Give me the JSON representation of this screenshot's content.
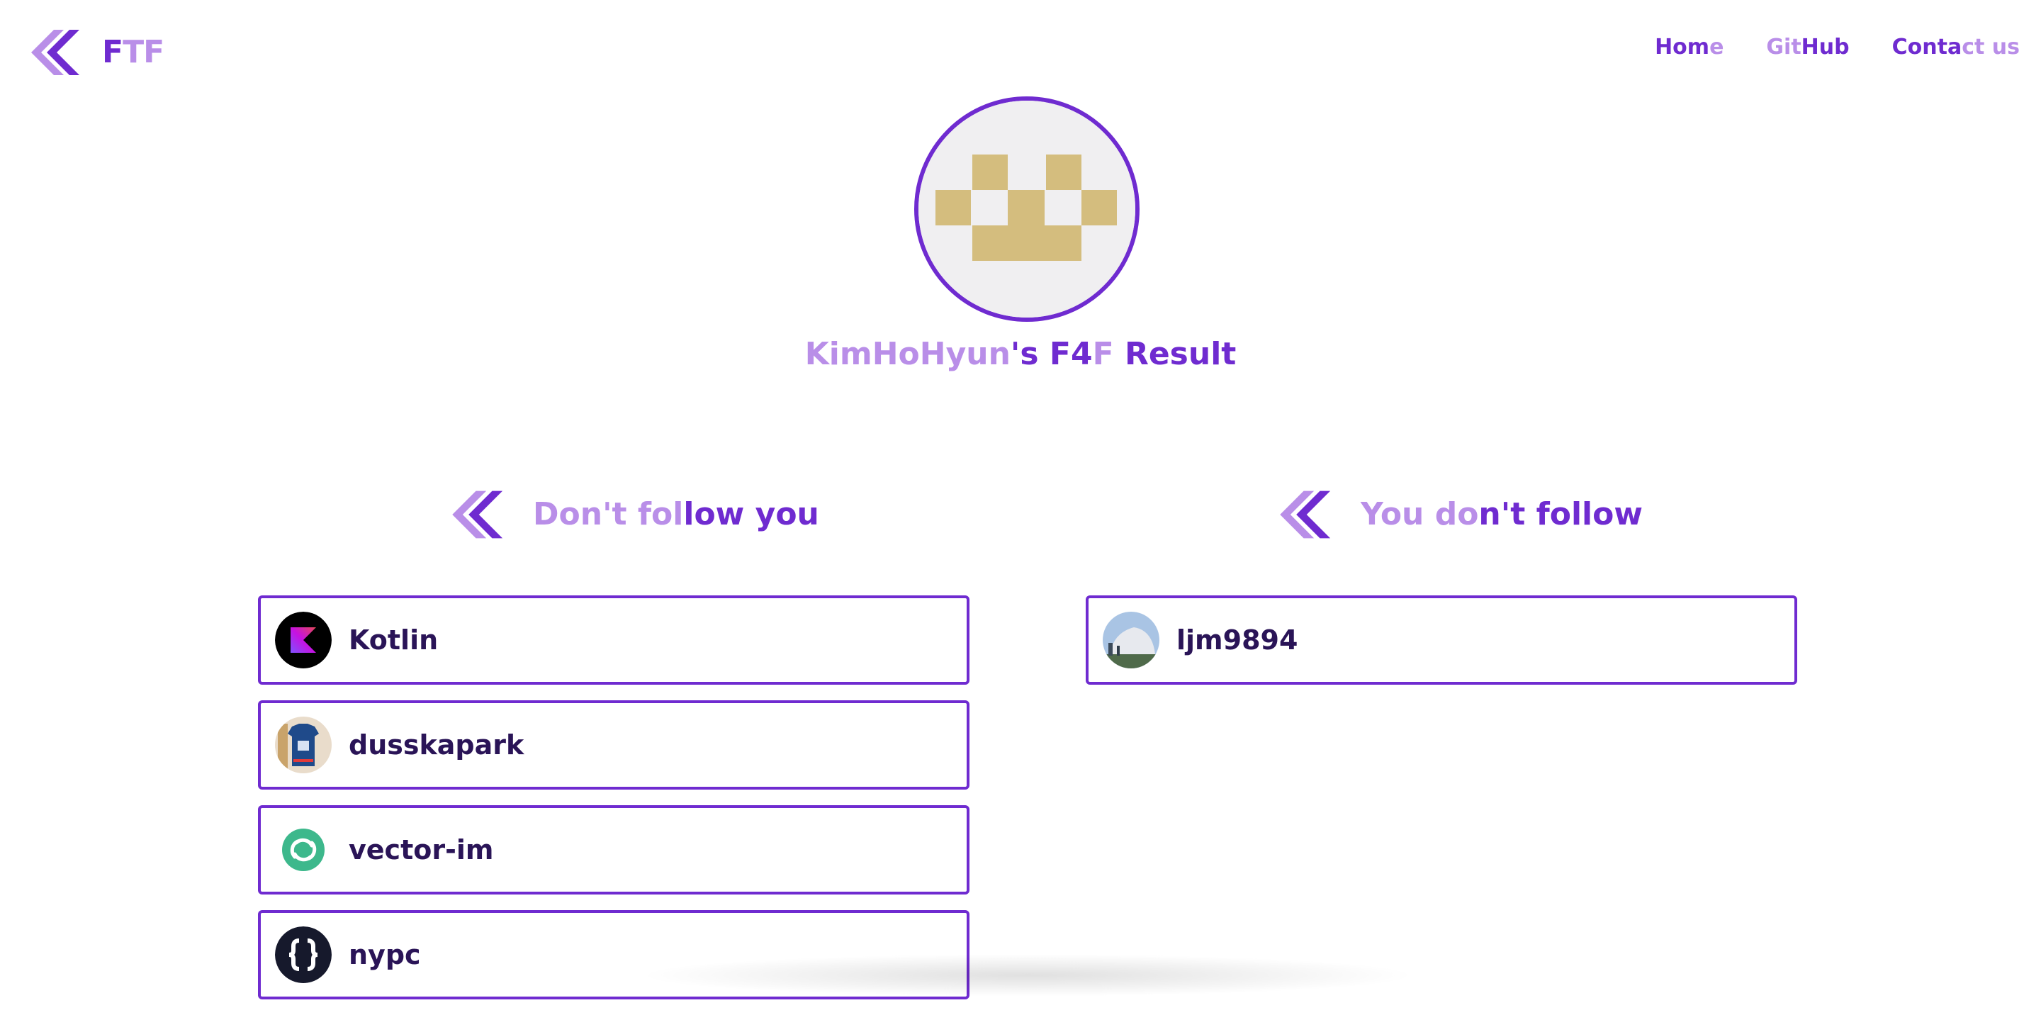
{
  "header": {
    "logo": {
      "text": "FTF",
      "icon": "ftf-diamond-logo-icon"
    },
    "nav": [
      {
        "label": "Home"
      },
      {
        "label": "GitHub"
      },
      {
        "label": "Contact us"
      }
    ]
  },
  "hero": {
    "avatar_icon": "identicon-avatar",
    "title": "KimHoHyun's F4F Result"
  },
  "sections": {
    "dont_follow_you": {
      "icon": "ftf-diamond-logo-icon",
      "title": "Don't follow you",
      "users": [
        {
          "name": "Kotlin",
          "avatar": "kotlin-logo"
        },
        {
          "name": "dusskapark",
          "avatar": "jersey-photo"
        },
        {
          "name": "vector-im",
          "avatar": "element-logo"
        },
        {
          "name": "nypc",
          "avatar": "braces-logo"
        }
      ]
    },
    "you_dont_follow": {
      "icon": "ftf-diamond-logo-icon",
      "title": "You don't follow",
      "users": [
        {
          "name": "ljm9894",
          "avatar": "dome-photo"
        }
      ]
    }
  },
  "colors": {
    "primary": "#6f2bd0",
    "light": "#b98ee8",
    "text_dark": "#2a1457",
    "identicon": "#d4bd7e",
    "avatar_bg": "#f0eff1"
  }
}
